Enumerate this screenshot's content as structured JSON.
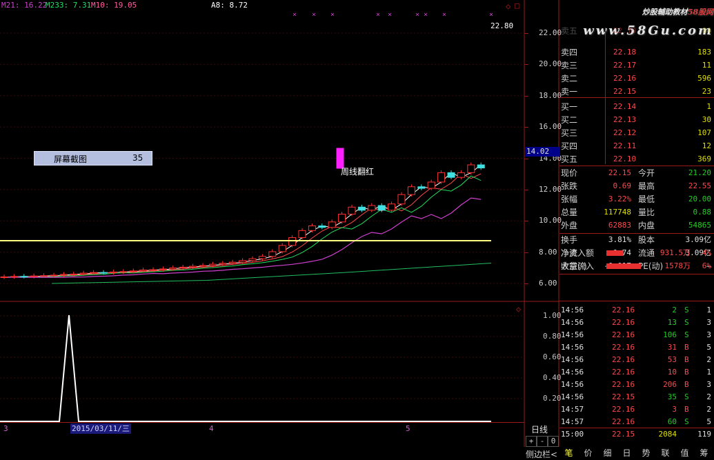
{
  "indicators": {
    "ma21": "M21: 16.22",
    "ma233": "M233: 7.31",
    "ma10": "M10: 19.05",
    "a8": "A8: 8.72"
  },
  "watermark": {
    "line1_prefix": "炒股輔助教材",
    "line1_brand": "58股网",
    "line2": "www.58Gu.com"
  },
  "tooltip": {
    "label": "屏幕截图",
    "value": "35"
  },
  "annotation": "周线翻红",
  "peak_label": "22.80",
  "price_axis": [
    "22.00",
    "20.00",
    "18.00",
    "16.00",
    "14.00",
    "12.00",
    "10.00",
    "8.00",
    "6.00"
  ],
  "price_flag": "14.02",
  "sub_axis": [
    "1.00",
    "0.80",
    "0.60",
    "0.40",
    "0.20"
  ],
  "date_box": "2015/03/11/三",
  "date_ticks": [
    "3",
    "4",
    "5"
  ],
  "period_label": "日线",
  "zoom_buttons": [
    "+",
    "-",
    "0"
  ],
  "sidebar_toggle": "侧边栏<",
  "order_book": {
    "asks": [
      {
        "label": "卖五",
        "price": "22.19",
        "vol": "84"
      },
      {
        "label": "卖四",
        "price": "22.18",
        "vol": "183"
      },
      {
        "label": "卖三",
        "price": "22.17",
        "vol": "11"
      },
      {
        "label": "卖二",
        "price": "22.16",
        "vol": "596"
      },
      {
        "label": "卖一",
        "price": "22.15",
        "vol": "23"
      }
    ],
    "bids": [
      {
        "label": "买一",
        "price": "22.14",
        "vol": "1"
      },
      {
        "label": "买二",
        "price": "22.13",
        "vol": "30"
      },
      {
        "label": "买三",
        "price": "22.12",
        "vol": "107"
      },
      {
        "label": "买四",
        "price": "22.11",
        "vol": "12"
      },
      {
        "label": "买五",
        "price": "22.10",
        "vol": "369"
      }
    ]
  },
  "quote": {
    "now_label": "现价",
    "now": "22.15",
    "open_label": "今开",
    "open": "21.20",
    "chg_label": "张跌",
    "chg": "0.69",
    "high_label": "最高",
    "high": "22.55",
    "pct_label": "张幅",
    "pct": "3.22%",
    "low_label": "最低",
    "low": "20.00",
    "vol_label": "总量",
    "vol": "117748",
    "ratio_label": "量比",
    "ratio": "0.88",
    "out_label": "外盘",
    "out": "62883",
    "in_label": "内盘",
    "in": "54865",
    "turnover_label": "换手",
    "turnover": "3.81%",
    "equity_label": "股本",
    "equity": "3.09亿",
    "nav_label": "净资",
    "nav": "0.74",
    "float_label": "流通",
    "float": "3.09亿",
    "eps_label": "收益(-)",
    "eps": "-0.017",
    "pe_label": "PE(动)",
    "pe": "—",
    "netflow_label": "净流入额",
    "netflow": "931.5万",
    "netflow_pct": "4%",
    "netflow_bar": 0.45,
    "block_label": "大宗流入",
    "block": "1578万",
    "block_pct": "6%",
    "block_bar": 0.9
  },
  "ticks": [
    {
      "time": "14:56",
      "price": "22.16",
      "vol": "2",
      "side": "S",
      "n": "1"
    },
    {
      "time": "14:56",
      "price": "22.16",
      "vol": "13",
      "side": "S",
      "n": "3"
    },
    {
      "time": "14:56",
      "price": "22.16",
      "vol": "106",
      "side": "S",
      "n": "3"
    },
    {
      "time": "14:56",
      "price": "22.16",
      "vol": "31",
      "side": "B",
      "n": "5"
    },
    {
      "time": "14:56",
      "price": "22.16",
      "vol": "53",
      "side": "B",
      "n": "2"
    },
    {
      "time": "14:56",
      "price": "22.16",
      "vol": "10",
      "side": "B",
      "n": "1"
    },
    {
      "time": "14:56",
      "price": "22.16",
      "vol": "206",
      "side": "B",
      "n": "3"
    },
    {
      "time": "14:56",
      "price": "22.15",
      "vol": "35",
      "side": "S",
      "n": "2"
    },
    {
      "time": "14:57",
      "price": "22.16",
      "vol": "3",
      "side": "B",
      "n": "2"
    },
    {
      "time": "14:57",
      "price": "22.16",
      "vol": "60",
      "side": "S",
      "n": "5"
    },
    {
      "time": "15:00",
      "price": "22.15",
      "vol": "2084",
      "side": "",
      "n": "119"
    }
  ],
  "tabs": [
    "笔",
    "价",
    "细",
    "日",
    "势",
    "联",
    "值",
    "筹"
  ],
  "active_tab": 0
}
